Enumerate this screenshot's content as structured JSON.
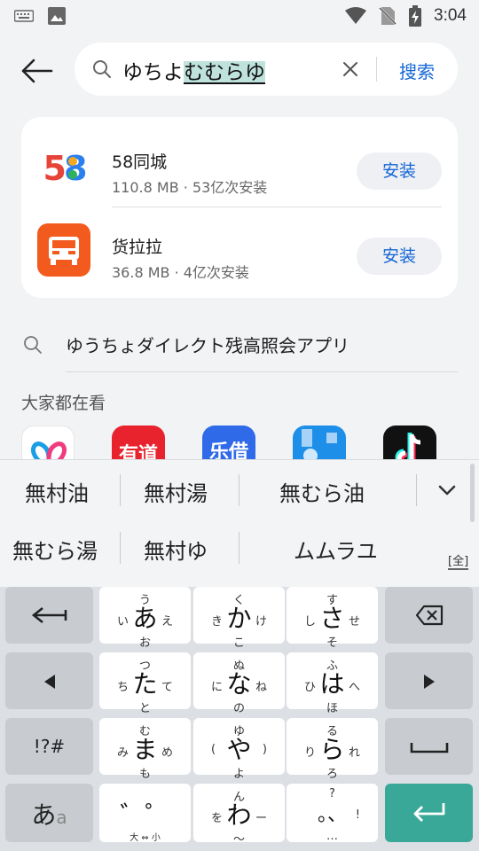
{
  "status_bar": {
    "time": "3:04",
    "icons": [
      "keyboard-icon",
      "image-icon",
      "wifi-icon",
      "no-sim-icon",
      "battery-charging-icon"
    ]
  },
  "search": {
    "query_plain": "ゆちよ",
    "query_composing": "むむらゆ",
    "search_button": "搜索",
    "icon": "search-icon",
    "clear_icon": "close-icon"
  },
  "apps": [
    {
      "name": "58同城",
      "meta": "110.8 MB · 53亿次安装",
      "install_label": "安装",
      "logo_text": "58",
      "colors": [
        "#2c80ee",
        "#f2a81f",
        "#e64339",
        "#2fb25b"
      ]
    },
    {
      "name": "货拉拉",
      "meta": "36.8 MB · 4亿次安装",
      "install_label": "安装",
      "logo_color": "#f35a1e"
    }
  ],
  "suggestion": {
    "text": "ゆうちょダイレクト残高照会アプリ"
  },
  "section": {
    "title": "大家都在看"
  },
  "popular_apps": [
    {
      "label": "",
      "color": "#ffffff"
    },
    {
      "label": "有道",
      "color": "#e8232e"
    },
    {
      "label": "乐借",
      "color": "#2f6ae8"
    },
    {
      "label": "",
      "color": "#1e8fe8"
    },
    {
      "label": "",
      "color": "#111111"
    }
  ],
  "keyboard": {
    "candidates_row1": [
      "無村油",
      "無村湯",
      "無むら油"
    ],
    "candidates_row2": [
      "無むら湯",
      "無村ゆ",
      "ムムラユ"
    ],
    "expand_icon": "chevron-down-icon",
    "full_width_badge": "[全]",
    "kana_keys": [
      {
        "center": "あ",
        "top": "う",
        "left": "い",
        "right": "え",
        "bottom": "お"
      },
      {
        "center": "か",
        "top": "く",
        "left": "き",
        "right": "け",
        "bottom": "こ"
      },
      {
        "center": "さ",
        "top": "す",
        "left": "し",
        "right": "せ",
        "bottom": "そ"
      },
      {
        "center": "た",
        "top": "つ",
        "left": "ち",
        "right": "て",
        "bottom": "と"
      },
      {
        "center": "な",
        "top": "ぬ",
        "left": "に",
        "right": "ね",
        "bottom": "の"
      },
      {
        "center": "は",
        "top": "ふ",
        "left": "ひ",
        "right": "へ",
        "bottom": "ほ"
      },
      {
        "center": "ま",
        "top": "む",
        "left": "み",
        "right": "め",
        "bottom": "も"
      },
      {
        "center": "や",
        "top": "ゆ",
        "left": "(",
        "right": ")",
        "bottom": "よ"
      },
      {
        "center": "ら",
        "top": "る",
        "left": "り",
        "right": "れ",
        "bottom": "ろ"
      },
      {
        "center": "゛゜",
        "top": "",
        "left": "",
        "right": "",
        "bottom": "大 ⇔ 小"
      },
      {
        "center": "わ",
        "top": "ん",
        "left": "を",
        "right": "ー",
        "bottom": "〜"
      },
      {
        "center": "。、",
        "top": "?",
        "left": "",
        "right": "!",
        "bottom": "…"
      }
    ],
    "symbols_key": "!?#",
    "mode_key_main": "あ",
    "mode_key_sub": "a",
    "enter_color": "#3aa898"
  }
}
